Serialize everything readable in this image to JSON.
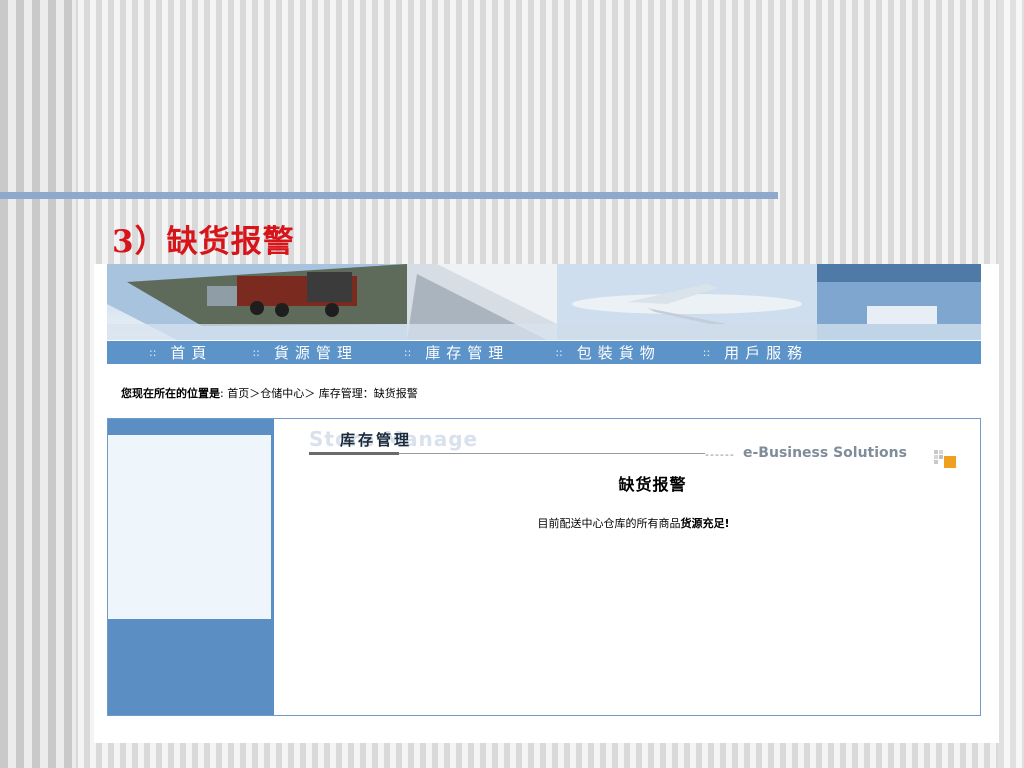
{
  "slide": {
    "title": "3）缺货报警"
  },
  "nav": {
    "bullet": "::",
    "items": [
      {
        "label": "首頁"
      },
      {
        "label": "貨源管理"
      },
      {
        "label": "庫存管理"
      },
      {
        "label": "包裝貨物"
      },
      {
        "label": "用戶服務"
      }
    ]
  },
  "breadcrumb": {
    "label": "您现在所在的位置是",
    "separator": ":",
    "path": "首页＞仓储中心＞ 库存管理：缺货报警"
  },
  "section": {
    "title": "库存管理",
    "ghost_text": "Store Manage",
    "dashes": "------",
    "tagline": "e-Business Solutions"
  },
  "alert": {
    "heading": "缺货报警",
    "message_prefix": "目前配送中心仓库的所有商品",
    "message_emphasis": "货源充足",
    "message_suffix": "!"
  },
  "colors": {
    "title_red": "#d7141a",
    "nav_blue": "#5c93c8",
    "panel_border": "#6e9bc7",
    "sidebar_blue": "#5b8fc4",
    "sidebar_light": "#eef5fb",
    "rule": "#8ea9cc",
    "deco_orange": "#f0a020"
  }
}
